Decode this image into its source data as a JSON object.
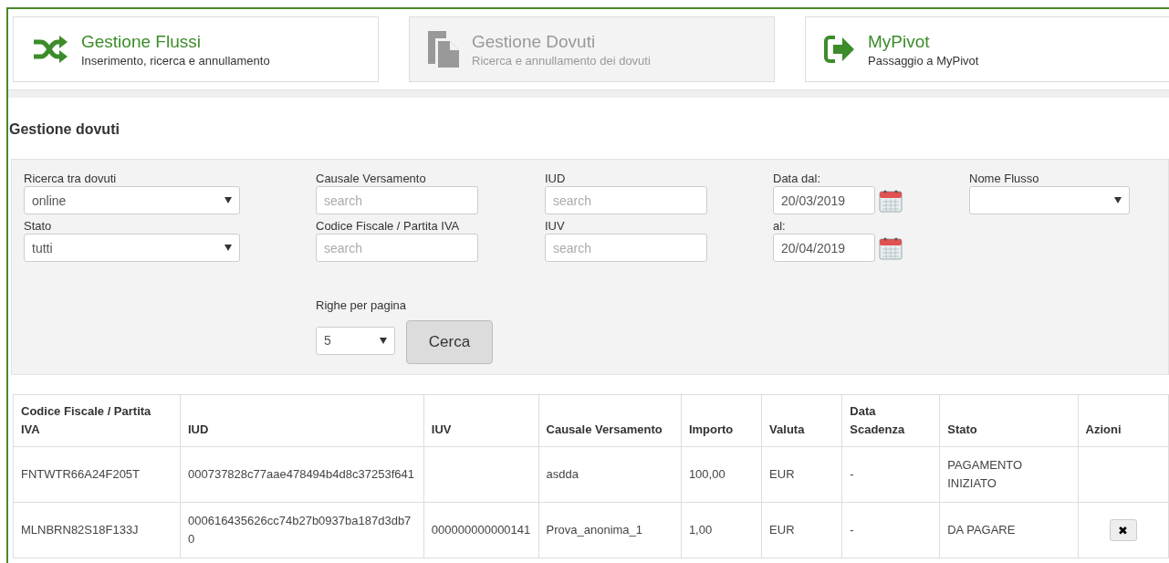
{
  "nav_cards": [
    {
      "kind": "shuffle",
      "title": "Gestione Flussi",
      "subtitle": "Inserimento, ricerca e annullamento",
      "disabled": false
    },
    {
      "kind": "document",
      "title": "Gestione Dovuti",
      "subtitle": "Ricerca e annullamento dei dovuti",
      "disabled": true
    },
    {
      "kind": "signin",
      "title": "MyPivot",
      "subtitle": "Passaggio a MyPivot",
      "disabled": false
    }
  ],
  "page_title": "Gestione dovuti",
  "filters": {
    "columns": [
      {
        "fields": [
          {
            "kind": "select",
            "label": "Ricerca tra dovuti",
            "value": "online"
          },
          {
            "kind": "select",
            "label": "Stato",
            "value": "tutti"
          }
        ]
      },
      {
        "fields": [
          {
            "kind": "text",
            "label": "Causale Versamento",
            "placeholder": "search"
          },
          {
            "kind": "text",
            "label": "Codice Fiscale / Partita IVA",
            "placeholder": "search"
          }
        ]
      },
      {
        "fields": [
          {
            "kind": "text",
            "label": "IUD",
            "placeholder": "search"
          },
          {
            "kind": "text",
            "label": "IUV",
            "placeholder": "search"
          }
        ]
      },
      {
        "fields": [
          {
            "kind": "date",
            "label": "Data dal:",
            "value": "20/03/2019"
          },
          {
            "kind": "date",
            "label": "al:",
            "value": "20/04/2019"
          }
        ]
      },
      {
        "fields": [
          {
            "kind": "select",
            "label": "Nome Flusso"
          }
        ]
      }
    ],
    "rows_per_page": {
      "label": "Righe per pagina",
      "value": "5"
    },
    "search_button": "Cerca"
  },
  "table": {
    "columns": [
      "Codice Fiscale / Partita IVA",
      "IUD",
      "IUV",
      "Causale Versamento",
      "Importo",
      "Valuta",
      "Data Scadenza",
      "Stato",
      "Azioni"
    ],
    "rows": [
      {
        "cells": [
          "FNTWTR66A24F205T",
          "000737828c77aae478494b4d8c37253f641",
          "",
          "asdda",
          "100,00",
          "EUR",
          "-",
          "PAGAMENTO INIZIATO"
        ]
      },
      {
        "cells": [
          "MLNBRN82S18F133J",
          "000616435626cc74b27b0937ba187d3db70",
          "000000000000141",
          "Prova_anonima_1",
          "1,00",
          "EUR",
          "-",
          "DA PAGARE"
        ],
        "action": "✖"
      }
    ]
  }
}
